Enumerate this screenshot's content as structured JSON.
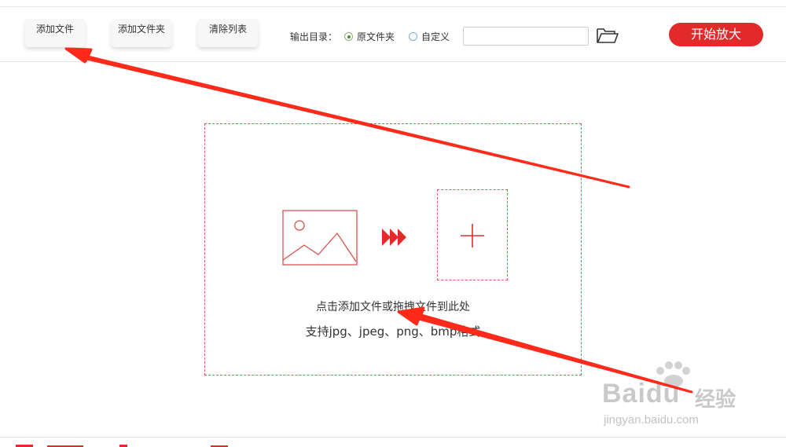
{
  "toolbar": {
    "add_file": "添加文件",
    "add_folder": "添加文件夹",
    "clear_list": "清除列表",
    "output_dir_label": "输出目录：",
    "radio_original": "原文件夹",
    "radio_custom": "自定义",
    "radio_selected": "原文件夹",
    "path_value": "",
    "path_placeholder": "",
    "folder_icon": "folder-open-icon",
    "start_label": "开始放大"
  },
  "dropzone": {
    "image_icon": "image-icon",
    "arrows_icon": "triple-arrow-icon",
    "plus_icon": "plus-icon",
    "hint_line1": "点击添加文件或拖拽文件到此处",
    "hint_line2": "支持jpg、jpeg、png、bmp格式"
  },
  "watermark": {
    "brand": "Baidu",
    "brand_cn": "经验",
    "url": "jingyan.baidu.com"
  },
  "colors": {
    "accent": "#e32a2a",
    "dashed_border": "#e05a5a",
    "annotation_arrow": "#ff2a1a"
  }
}
